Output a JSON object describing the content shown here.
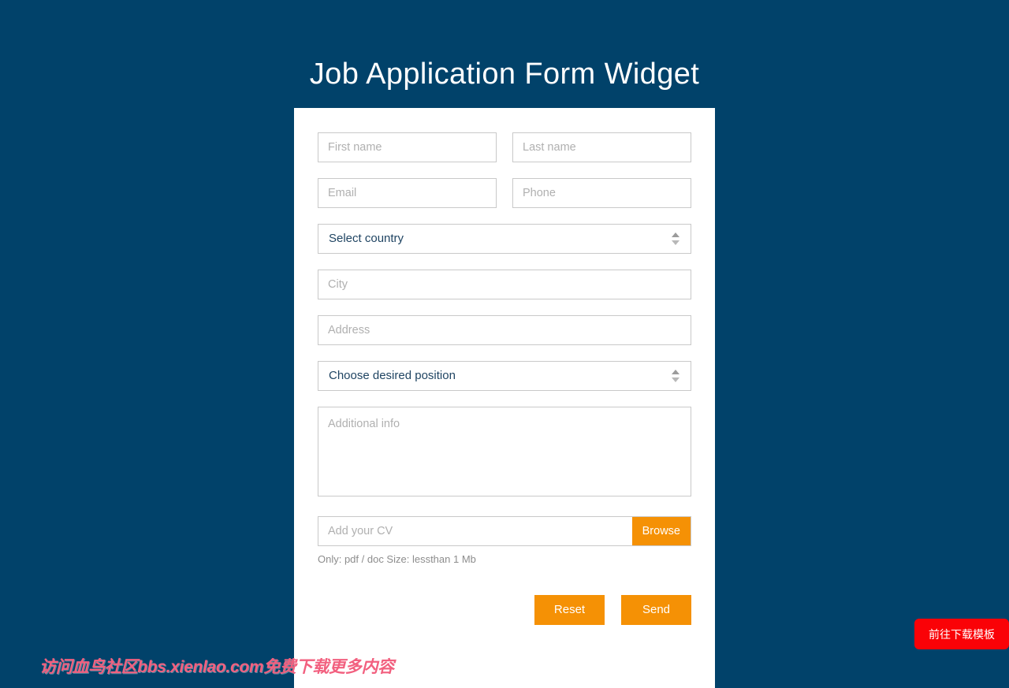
{
  "page": {
    "title": "Job Application Form Widget",
    "background_color": "#01426a",
    "accent_color": "#f59105",
    "card_background": "#ffffff"
  },
  "form": {
    "first_name": {
      "placeholder": "First name",
      "value": ""
    },
    "last_name": {
      "placeholder": "Last name",
      "value": ""
    },
    "email": {
      "placeholder": "Email",
      "value": ""
    },
    "phone": {
      "placeholder": "Phone",
      "value": ""
    },
    "country_select": {
      "selected": "Select country"
    },
    "city": {
      "placeholder": "City",
      "value": ""
    },
    "address": {
      "placeholder": "Address",
      "value": ""
    },
    "position_select": {
      "selected": "Choose desired position"
    },
    "additional_info": {
      "placeholder": "Additional info",
      "value": ""
    },
    "cv_upload": {
      "placeholder": "Add your CV",
      "value": "",
      "browse_label": "Browse",
      "hint": "Only: pdf / doc Size: lessthan 1 Mb"
    },
    "buttons": {
      "reset_label": "Reset",
      "send_label": "Send"
    }
  },
  "overlays": {
    "watermark_text": "访问血鸟社区bbs.xienlao.com免费下载更多内容",
    "watermark_color": "#f2607f",
    "cta_label": "前往下载模板",
    "cta_color": "#fa0207"
  }
}
